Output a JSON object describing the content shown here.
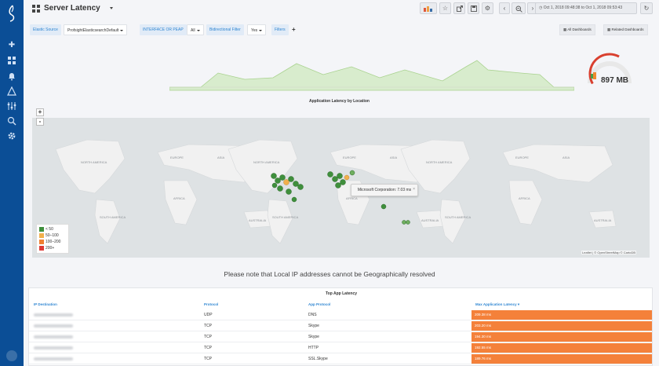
{
  "header": {
    "title": "Server Latency",
    "time_range": "Oct 1, 2018 09:48:38 to Oct 1, 2018 09:53:43"
  },
  "filters": [
    {
      "label": "Elastic Source",
      "value": "ProfsightElasticsearchDefault"
    },
    {
      "label": "INTERFACE OR PEAP",
      "value": "All"
    },
    {
      "label": "Bidirectional Filter",
      "value": "Yes"
    }
  ],
  "filters_button": "Filters",
  "add_filter": "+",
  "dash_links": {
    "all": "All Dashboards",
    "related": "Related Dashboards"
  },
  "gauge": {
    "value": "897 MB",
    "fill_fraction": 0.62
  },
  "map": {
    "title": "Application Latency by Location",
    "zoom_in": "+",
    "zoom_out": "-",
    "tooltip": "Microsoft Corporation: 7.03 ms",
    "tooltip_close": "×",
    "legend": [
      {
        "label": "< 50",
        "color": "#3f8f3c"
      },
      {
        "label": "50–100",
        "color": "#f1b04c"
      },
      {
        "label": "100–200",
        "color": "#f07f31"
      },
      {
        "label": "200+",
        "color": "#de3a35"
      }
    ],
    "attribution": "Leaflet | © OpenStreetMap © CartoDB",
    "labels": [
      "NORTH AMERICA",
      "SOUTH AMERICA",
      "EUROPE",
      "AFRICA",
      "ASIA",
      "AUSTRALIA"
    ]
  },
  "note": "Please note that Local IP addresses cannot be Geographically resolved",
  "table": {
    "title": "Top App Latency",
    "columns": [
      "IP Destination",
      "Protocol",
      "App Protocol",
      "Max Application Latency ▾"
    ],
    "rows": [
      {
        "protocol": "UDP",
        "app": "DNS",
        "latency": "209.38 ms"
      },
      {
        "protocol": "TCP",
        "app": "Skype",
        "latency": "203.20 ms"
      },
      {
        "protocol": "TCP",
        "app": "Skype",
        "latency": "194.30 ms"
      },
      {
        "protocol": "TCP",
        "app": "HTTP",
        "latency": "192.55 ms"
      },
      {
        "protocol": "TCP",
        "app": "SSL.Skype",
        "latency": "189.76 ms"
      }
    ]
  },
  "colors": {
    "sidebar": "#0b4e96",
    "accent": "#2f86d2",
    "latency": "#f4813a",
    "area": "#d8eccd"
  }
}
